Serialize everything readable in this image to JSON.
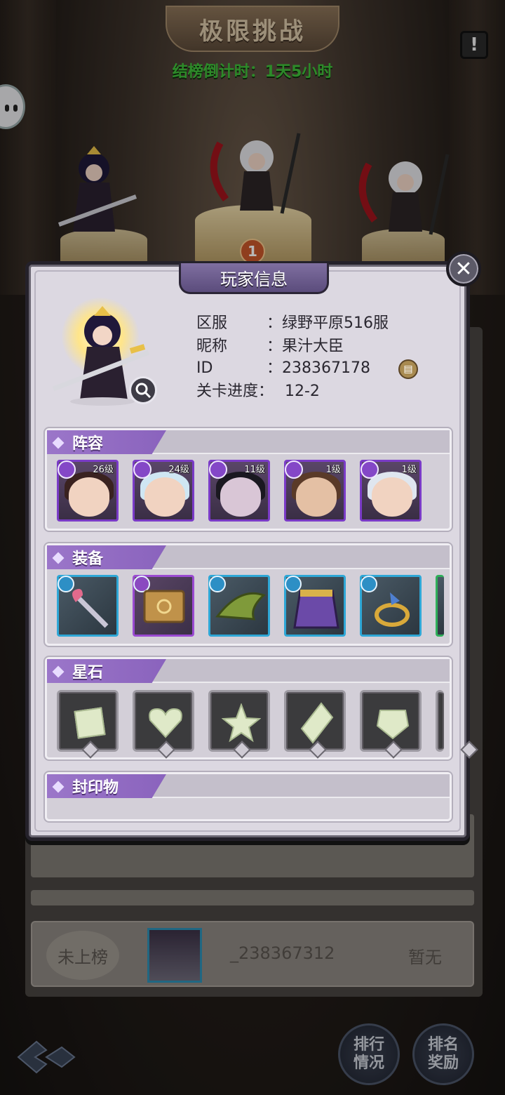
{
  "screen": {
    "title": "极限挑战",
    "countdown": "结榜倒计时：1天5小时",
    "info_icon": "exclamation-icon",
    "podium_rank_label": "1"
  },
  "ranking": {
    "my_row": {
      "rank": "未上榜",
      "name": "_238367312",
      "score": "暂无"
    },
    "buttons": {
      "ranking_status": "排行\n情况",
      "ranking_reward": "排名\n奖励"
    }
  },
  "dialog": {
    "title": "玩家信息",
    "close_icon": "close-icon",
    "info": {
      "server_label": "区服",
      "server_value": "：绿野平原516服",
      "nickname_label": "昵称",
      "nickname_value": "：果汁大臣",
      "id_label": "ID",
      "id_value": "：238367178",
      "progress_label": "关卡进度：",
      "progress_value": "12-2"
    },
    "sections": {
      "lineup": "阵容",
      "equipment": "装备",
      "star_stones": "星石",
      "seal": "封印物"
    },
    "lineup": [
      {
        "level": "26级"
      },
      {
        "level": "24级"
      },
      {
        "level": "11级"
      },
      {
        "level": "1级"
      },
      {
        "level": "1级"
      }
    ],
    "equipment": [
      "wand-icon",
      "book-icon",
      "hat-icon",
      "cape-icon",
      "ring-icon"
    ],
    "stones": [
      "square-gem-icon",
      "heart-gem-icon",
      "star-gem-icon",
      "diamond-gem-icon",
      "shield-gem-icon"
    ]
  },
  "colors": {
    "accent_purple": "#8a63bd",
    "countdown_green": "#3fbf3a",
    "equip_blue": "#2ea7d6"
  }
}
